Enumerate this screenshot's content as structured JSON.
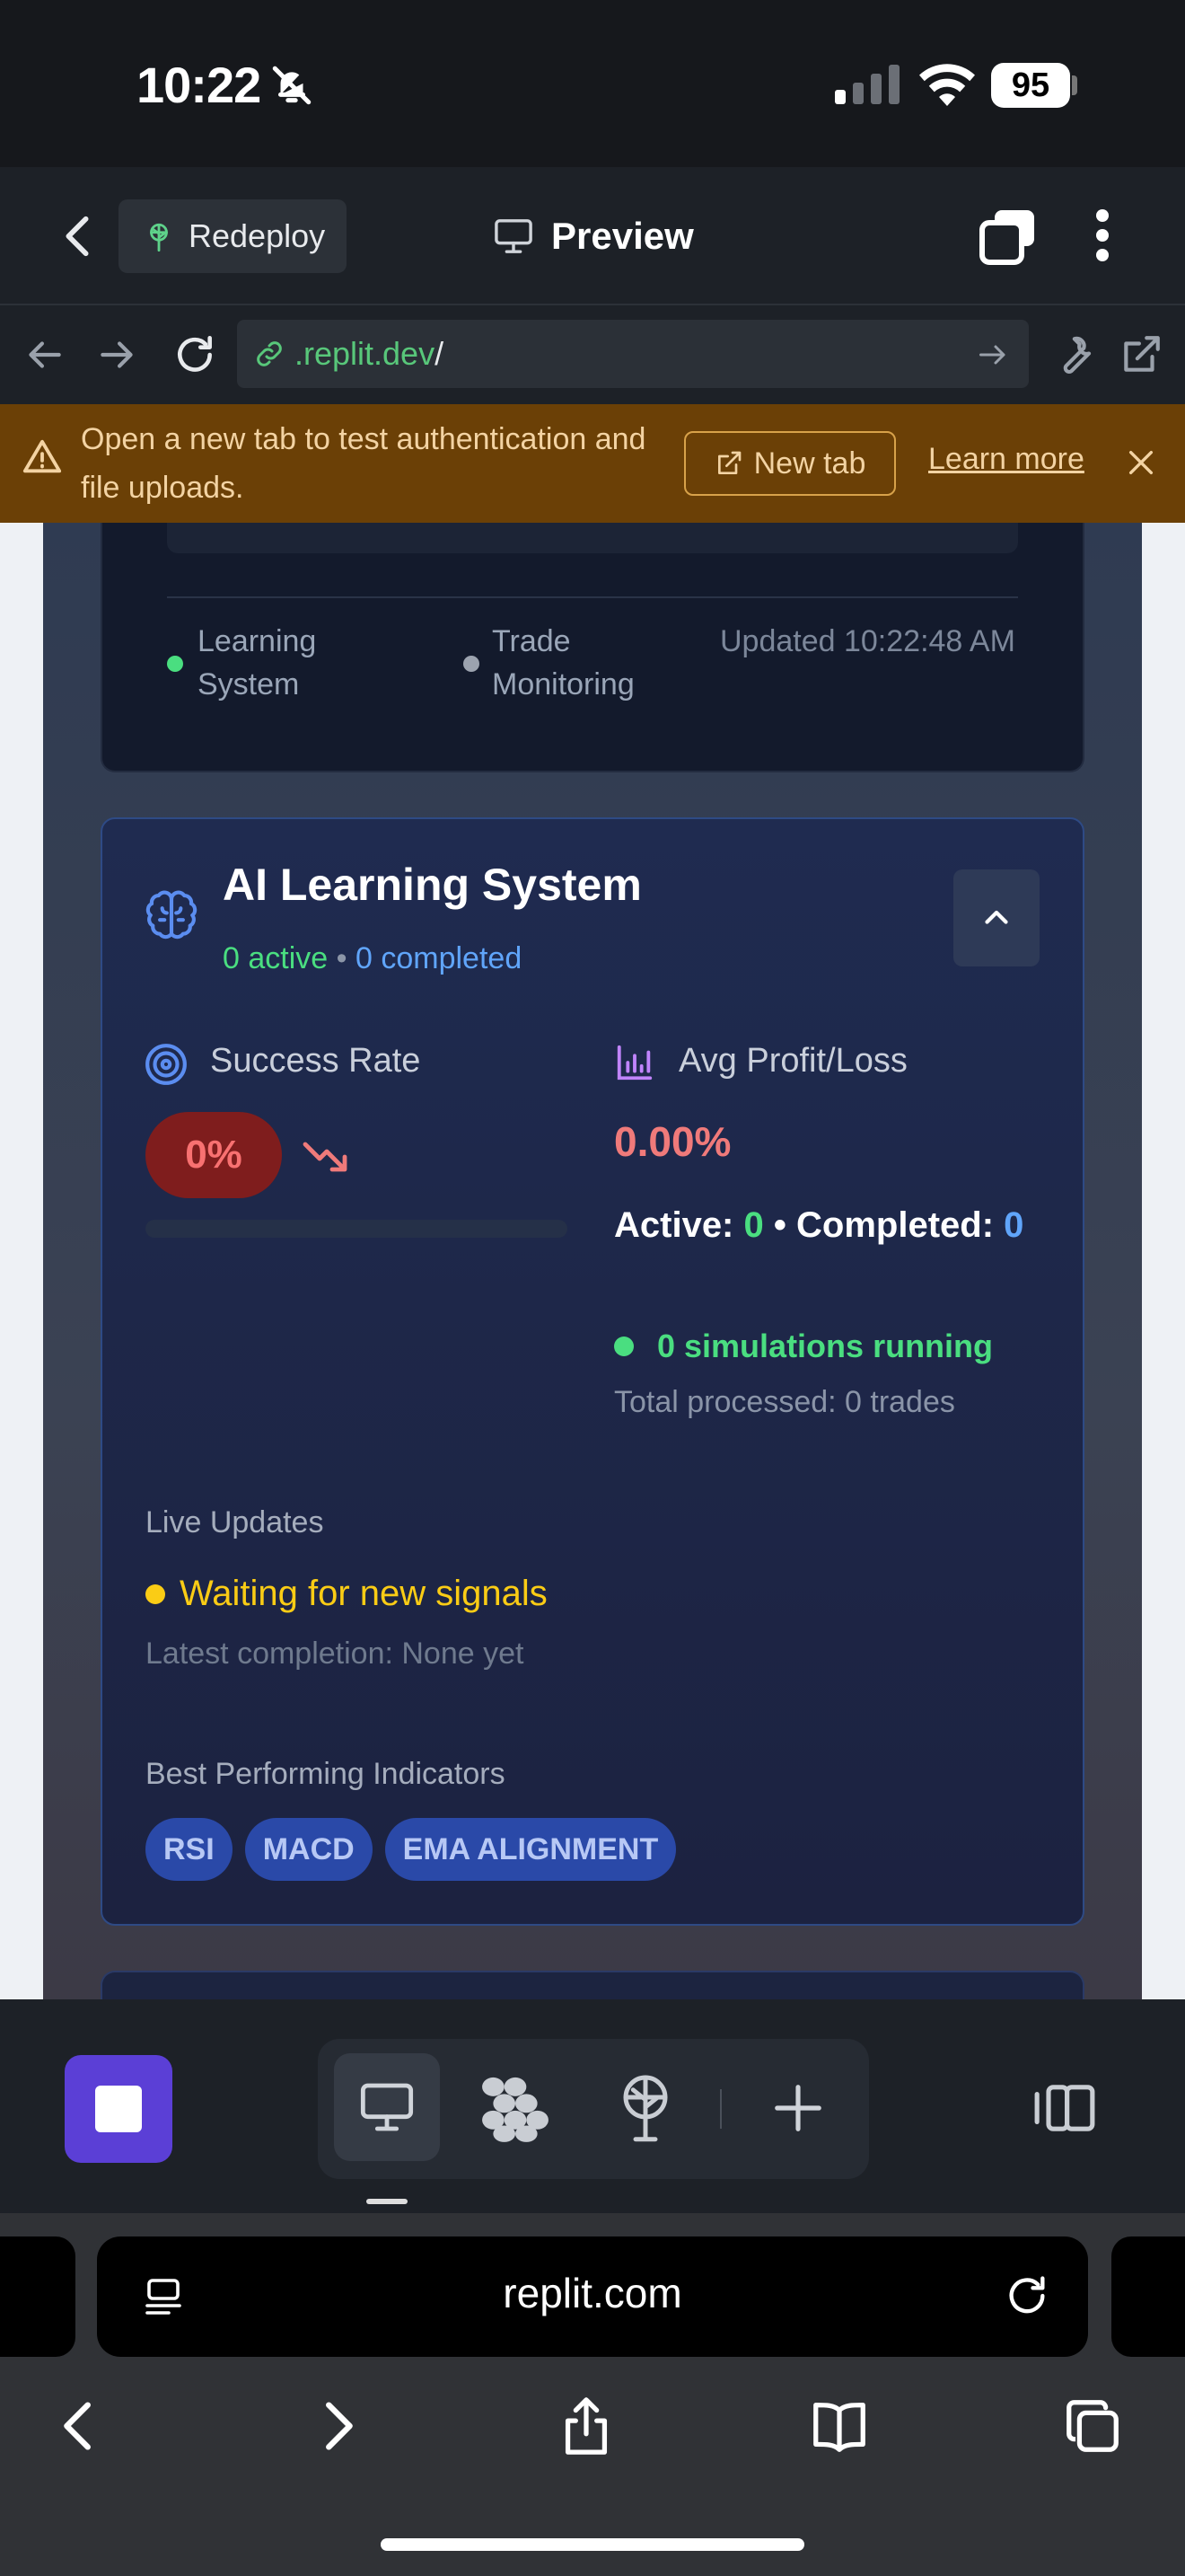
{
  "status_bar": {
    "time": "10:22",
    "battery": "95"
  },
  "app_header": {
    "redeploy_label": "Redeploy",
    "preview_label": "Preview"
  },
  "url_bar": {
    "url_highlight": ".replit.dev",
    "url_rest": "/"
  },
  "banner": {
    "message": "Open a new tab to test authentication and file uploads.",
    "new_tab_label": "New tab",
    "learn_more_label": "Learn more"
  },
  "status_row": {
    "learning": "Learning System",
    "trade": "Trade Monitoring",
    "updated": "Updated 10:22:48 AM",
    "colors": {
      "learning_dot": "#4ade80",
      "trade_dot": "#9ca3af"
    }
  },
  "ai_card": {
    "title": "AI Learning System",
    "active_sub": "0 active",
    "separator": "•",
    "completed_sub": "0 completed",
    "success_rate_label": "Success Rate",
    "success_rate_value": "0%",
    "success_rate_fill": 0,
    "avg_pl_label": "Avg Profit/Loss",
    "avg_pl_value": "0.00%",
    "active_label": "Active:",
    "active_value": "0",
    "completed_label": "• Completed:",
    "completed_value": "0",
    "simulations": "0 simulations running",
    "total_processed": "Total processed: 0 trades",
    "live_updates_label": "Live Updates",
    "waiting": "Waiting for new signals",
    "latest": "Latest completion: None yet",
    "best_label": "Best Performing Indicators",
    "indicators": [
      "RSI",
      "MACD",
      "EMA ALIGNMENT"
    ]
  },
  "safari": {
    "domain": "replit.com"
  },
  "colors": {
    "accent_purple": "#5b3fd6",
    "success_green": "#4ade80",
    "loss_red": "#f07a7a",
    "warning_yellow": "#facc15",
    "banner_bg": "#6b4006"
  },
  "icons": [
    "bell-slash-icon",
    "signal-icon",
    "wifi-icon",
    "back-chevron-icon",
    "tree-icon",
    "monitor-icon",
    "stack-icon",
    "kebab-icon",
    "arrow-left-icon",
    "arrow-right-icon",
    "reload-icon",
    "link-icon",
    "go-arrow-icon",
    "wrench-icon",
    "external-link-icon",
    "warning-icon",
    "close-icon",
    "brain-icon",
    "chevron-up-icon",
    "target-icon",
    "trend-down-icon",
    "bar-chart-icon",
    "console-icon",
    "grid-icon",
    "deploy-icon",
    "plus-icon",
    "split-view-icon",
    "tabs-menu-icon",
    "safari-reload-icon",
    "share-icon",
    "bookmarks-icon",
    "tabs-icon"
  ]
}
